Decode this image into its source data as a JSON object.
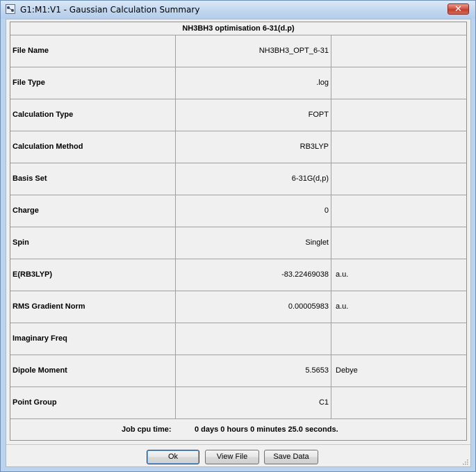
{
  "window": {
    "title": "G1:M1:V1 - Gaussian Calculation Summary",
    "close_label": "✕"
  },
  "summary": {
    "heading": "NH3BH3 optimisation 6-31(d.p)",
    "rows": [
      {
        "label": "File Name",
        "value": "NH3BH3_OPT_6-31",
        "unit": ""
      },
      {
        "label": "File Type",
        "value": ".log",
        "unit": ""
      },
      {
        "label": "Calculation Type",
        "value": "FOPT",
        "unit": ""
      },
      {
        "label": "Calculation Method",
        "value": "RB3LYP",
        "unit": ""
      },
      {
        "label": "Basis Set",
        "value": "6-31G(d,p)",
        "unit": ""
      },
      {
        "label": "Charge",
        "value": "0",
        "unit": ""
      },
      {
        "label": "Spin",
        "value": "Singlet",
        "unit": ""
      },
      {
        "label": "E(RB3LYP)",
        "value": "-83.22469038",
        "unit": "a.u."
      },
      {
        "label": "RMS Gradient Norm",
        "value": "0.00005983",
        "unit": "a.u."
      },
      {
        "label": "Imaginary Freq",
        "value": "",
        "unit": ""
      },
      {
        "label": "Dipole Moment",
        "value": "5.5653",
        "unit": "Debye"
      },
      {
        "label": "Point Group",
        "value": "C1",
        "unit": ""
      }
    ],
    "cpu_label": "Job cpu time:",
    "cpu_value": "0 days  0 hours  0 minutes 25.0 seconds."
  },
  "buttons": {
    "ok": "Ok",
    "view_file": "View File",
    "save_data": "Save Data"
  }
}
